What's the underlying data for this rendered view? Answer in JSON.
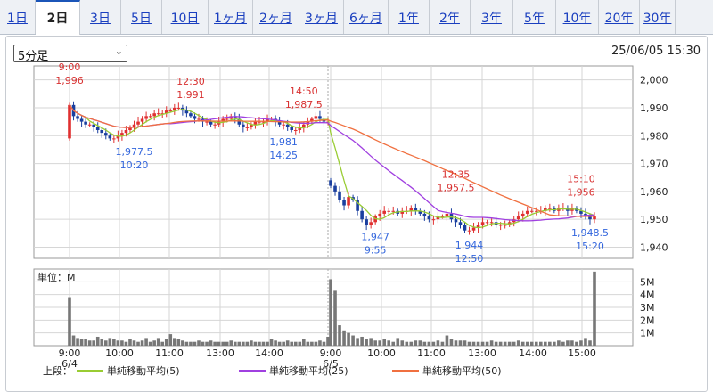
{
  "tabs": [
    {
      "label": "1日",
      "active": false
    },
    {
      "label": "2日",
      "active": true
    },
    {
      "label": "3日",
      "active": false
    },
    {
      "label": "5日",
      "active": false
    },
    {
      "label": "10日",
      "active": false
    },
    {
      "label": "1ヶ月",
      "active": false
    },
    {
      "label": "2ヶ月",
      "active": false
    },
    {
      "label": "3ヶ月",
      "active": false
    },
    {
      "label": "6ヶ月",
      "active": false
    },
    {
      "label": "1年",
      "active": false
    },
    {
      "label": "2年",
      "active": false
    },
    {
      "label": "3年",
      "active": false
    },
    {
      "label": "5年",
      "active": false
    },
    {
      "label": "10年",
      "active": false
    },
    {
      "label": "20年",
      "active": false
    },
    {
      "label": "30年",
      "active": false
    }
  ],
  "period_select": {
    "value": "5分足"
  },
  "timestamp": "25/06/05 15:30",
  "chart_data": {
    "type": "candlestick",
    "y_ticks": [
      "2,000",
      "1,990",
      "1,980",
      "1,970",
      "1,960",
      "1,950",
      "1,940"
    ],
    "ylim": [
      1936,
      2005
    ],
    "volume_unit_label": "単位：M",
    "volume_ticks": [
      "5M",
      "4M",
      "3M",
      "2M",
      "1M"
    ],
    "x_ticks": [
      "9:00",
      "10:00",
      "11:00",
      "13:00",
      "14:00",
      "9:00",
      "10:00",
      "11:00",
      "13:00",
      "14:00",
      "15:00"
    ],
    "date_labels": [
      "6/4",
      "6/5"
    ],
    "annotations": [
      {
        "time": "9:00",
        "value": "1,996",
        "kind": "high",
        "day": 1
      },
      {
        "time": "12:30",
        "value": "1,991",
        "kind": "high",
        "day": 1
      },
      {
        "time": "14:50",
        "value": "1,987.5",
        "kind": "high",
        "day": 1
      },
      {
        "time": "10:20",
        "value": "1,977.5",
        "kind": "low",
        "day": 1
      },
      {
        "time": "14:25",
        "value": "1,981",
        "kind": "low",
        "day": 1
      },
      {
        "time": "9:55",
        "value": "1,947",
        "kind": "low",
        "day": 2
      },
      {
        "time": "12:35",
        "value": "1,957.5",
        "kind": "high",
        "day": 2
      },
      {
        "time": "12:50",
        "value": "1,944",
        "kind": "low",
        "day": 2
      },
      {
        "time": "15:10",
        "value": "1,956",
        "kind": "high",
        "day": 2
      },
      {
        "time": "15:20",
        "value": "1,948.5",
        "kind": "low",
        "day": 2
      }
    ],
    "close_series": [
      1991,
      1987,
      1986,
      1985,
      1984,
      1984,
      1983,
      1982,
      1981,
      1980,
      1979,
      1979,
      1980,
      1981,
      1982,
      1983,
      1984,
      1985,
      1986,
      1987,
      1987,
      1988,
      1988,
      1988,
      1989,
      1989,
      1990,
      1990,
      1989,
      1988,
      1987,
      1986,
      1986,
      1985,
      1985,
      1984,
      1984,
      1985,
      1986,
      1986,
      1987,
      1986,
      1984,
      1983,
      1983,
      1984,
      1985,
      1985,
      1985,
      1986,
      1986,
      1985,
      1984,
      1984,
      1983,
      1982,
      1982,
      1983,
      1984,
      1985,
      1986,
      1987,
      1986,
      1985,
      1985,
      1962,
      1960,
      1957,
      1955,
      1958,
      1957,
      1953,
      1950,
      1948,
      1949,
      1951,
      1952,
      1953,
      1953,
      1953,
      1952,
      1953,
      1953,
      1954,
      1953,
      1952,
      1951,
      1950,
      1950,
      1951,
      1951,
      1952,
      1950,
      1949,
      1948,
      1946,
      1946,
      1947,
      1948,
      1949,
      1949,
      1949,
      1948,
      1948,
      1948,
      1949,
      1950,
      1951,
      1952,
      1953,
      1953,
      1953,
      1953,
      1954,
      1954,
      1953,
      1954,
      1954,
      1953,
      1954,
      1953,
      1952,
      1951,
      1950,
      1951
    ],
    "volume_series": [
      3.8,
      0.8,
      0.6,
      0.5,
      0.5,
      0.4,
      0.4,
      0.7,
      0.5,
      0.4,
      0.6,
      0.5,
      0.4,
      0.4,
      0.3,
      0.5,
      0.4,
      0.3,
      0.4,
      0.6,
      0.3,
      0.4,
      0.6,
      0.3,
      0.5,
      0.9,
      0.6,
      0.5,
      0.4,
      0.3,
      0.3,
      0.3,
      0.4,
      0.3,
      0.3,
      0.4,
      0.3,
      0.3,
      0.3,
      0.3,
      0.4,
      0.3,
      0.3,
      0.3,
      0.3,
      0.4,
      0.3,
      0.3,
      0.3,
      0.3,
      0.5,
      0.4,
      0.3,
      0.3,
      0.4,
      0.3,
      0.3,
      0.3,
      0.5,
      0.3,
      0.3,
      0.3,
      0.4,
      0.3,
      0.7,
      5.2,
      4.3,
      1.6,
      1.2,
      1.0,
      0.8,
      0.6,
      0.7,
      0.5,
      0.6,
      0.4,
      0.4,
      0.5,
      0.4,
      0.3,
      0.6,
      0.4,
      0.3,
      0.3,
      0.4,
      0.4,
      0.3,
      0.3,
      0.3,
      0.4,
      0.3,
      0.8,
      0.5,
      0.4,
      0.4,
      0.4,
      0.3,
      0.3,
      0.3,
      0.3,
      0.3,
      0.4,
      0.3,
      0.3,
      0.3,
      0.3,
      0.3,
      0.4,
      0.3,
      0.3,
      0.3,
      0.3,
      0.3,
      0.3,
      0.3,
      0.3,
      0.4,
      0.3,
      0.4,
      0.4,
      0.3,
      0.4,
      0.6,
      0.4,
      5.8
    ],
    "volume_ylim": [
      0,
      6
    ],
    "legend": [
      {
        "label": "上段：",
        "color": "#222222"
      },
      {
        "label": "単純移動平均(5)",
        "color": "#99cc33"
      },
      {
        "label": "単純移動平均(25)",
        "color": "#a040e0"
      },
      {
        "label": "単純移動平均(50)",
        "color": "#f07040"
      }
    ],
    "colors": {
      "up": "#e03030",
      "down": "#1a3f9f",
      "volume": "#777777",
      "high_label": "#d83030",
      "low_label": "#3366dd",
      "grid": "#d6d6d6"
    }
  }
}
